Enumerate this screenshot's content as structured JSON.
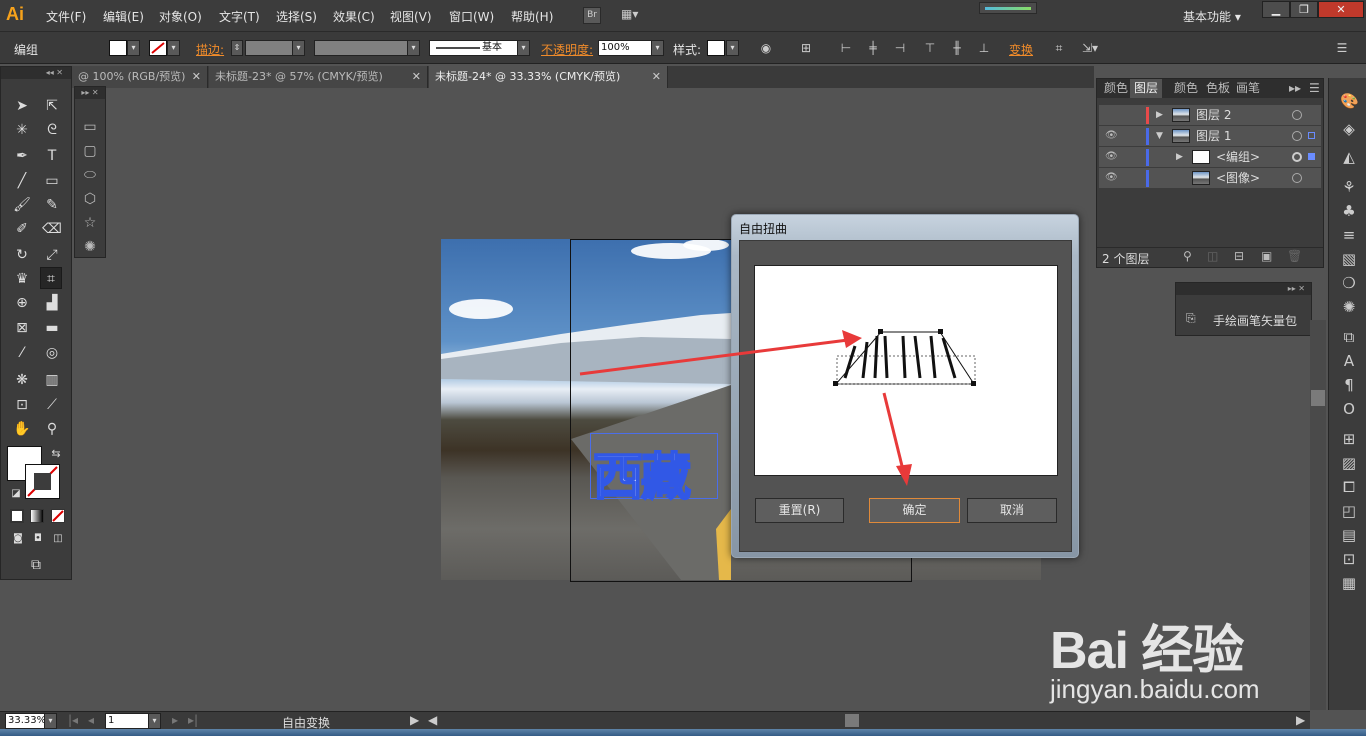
{
  "app": {
    "logo": "Ai"
  },
  "menu": [
    "文件(F)",
    "编辑(E)",
    "对象(O)",
    "文字(T)",
    "选择(S)",
    "效果(C)",
    "视图(V)",
    "窗口(W)",
    "帮助(H)"
  ],
  "menubar": {
    "bridge": "Br",
    "workspace": "基本功能"
  },
  "control": {
    "selection": "编组",
    "stroke_label": "描边",
    "brush_name": "基本",
    "opacity_label": "不透明度",
    "opacity_value": "100%",
    "style_label": "样式",
    "transform_label": "变换"
  },
  "tabs": [
    {
      "label": "@ 100% (RGB/预览)",
      "active": false
    },
    {
      "label": "未标题-23* @ 57% (CMYK/预览)",
      "active": false
    },
    {
      "label": "未标题-24* @ 33.33% (CMYK/预览)",
      "active": true
    }
  ],
  "artwork": {
    "text": "西藏"
  },
  "dialog": {
    "title": "自由扭曲",
    "reset": "重置(R)",
    "ok": "确定",
    "cancel": "取消"
  },
  "layers_panel": {
    "tabs": [
      "颜色",
      "图层",
      "颜色",
      "色板",
      "画笔"
    ],
    "active_tab": 1,
    "rows": [
      {
        "name": "图层 2",
        "color": "#e84a4a"
      },
      {
        "name": "图层 1",
        "color": "#4a6ae8"
      },
      {
        "name": "<编组>",
        "color": "#4a6ae8"
      },
      {
        "name": "<图像>",
        "color": "#4a6ae8"
      }
    ],
    "footer": "2 个图层"
  },
  "brush_panel": {
    "item": "手绘画笔矢量包"
  },
  "status": {
    "zoom": "33.33%",
    "page": "1",
    "tool": "自由变换"
  },
  "watermark": {
    "logo": "Bai 经验",
    "sub": "jingyan.baidu.com"
  }
}
